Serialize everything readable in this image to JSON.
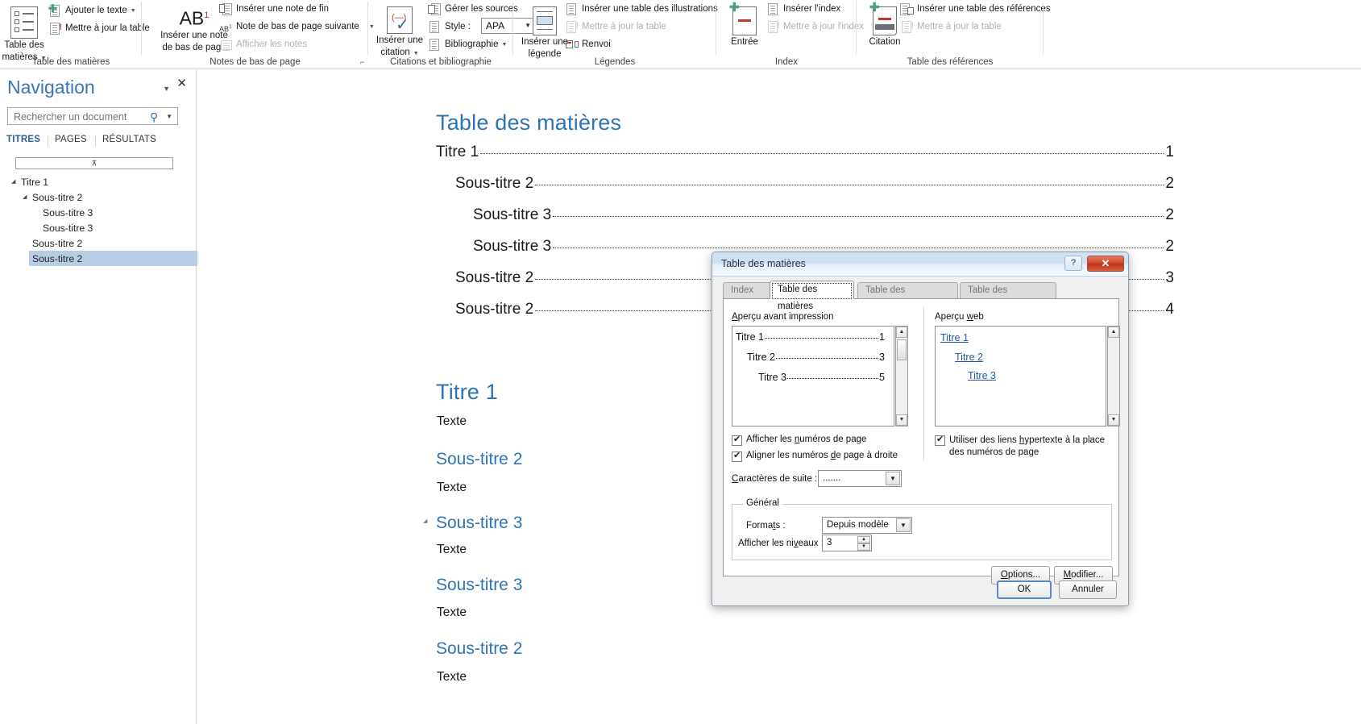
{
  "ribbon": {
    "groups": [
      {
        "name": "Table des matières",
        "big": {
          "label_line1": "Table des",
          "label_line2": "matières",
          "icon": "toc-icon"
        },
        "items": [
          {
            "label": "Ajouter le texte",
            "icon": "add-text-icon",
            "caret": true,
            "disabled": false
          },
          {
            "label": "Mettre à jour la table",
            "icon": "update-table-icon",
            "caret": false,
            "disabled": false
          }
        ]
      },
      {
        "name": "Notes de bas de page",
        "big": {
          "label_line1": "Insérer une note",
          "label_line2": "de bas de page",
          "icon": "footnote-ab-icon"
        },
        "items": [
          {
            "label": "Insérer une note de fin",
            "icon": "endnote-icon",
            "caret": false,
            "disabled": false
          },
          {
            "label": "Note de bas de page suivante",
            "icon": "next-footnote-icon",
            "caret": true,
            "disabled": false
          },
          {
            "label": "Afficher les notes",
            "icon": "show-notes-icon",
            "caret": false,
            "disabled": true
          }
        ]
      },
      {
        "name": "Citations et bibliographie",
        "big": {
          "label_line1": "Insérer une",
          "label_line2": "citation",
          "icon": "insert-citation-icon",
          "caret": true
        },
        "items": [
          {
            "label": "Gérer les sources",
            "icon": "manage-sources-icon",
            "caret": false,
            "disabled": false
          },
          {
            "label": "Style :",
            "icon": "style-icon",
            "caret": false,
            "disabled": false,
            "combo_value": "APA"
          },
          {
            "label": "Bibliographie",
            "icon": "bibliography-icon",
            "caret": true,
            "disabled": false
          }
        ]
      },
      {
        "name": "Légendes",
        "big": {
          "label_line1": "Insérer une",
          "label_line2": "légende",
          "icon": "insert-caption-icon"
        },
        "items": [
          {
            "label": "Insérer une table des illustrations",
            "icon": "table-of-figures-icon",
            "caret": false,
            "disabled": false
          },
          {
            "label": "Mettre à jour la table",
            "icon": "update-table-icon",
            "caret": false,
            "disabled": true
          },
          {
            "label": "Renvoi",
            "icon": "cross-reference-icon",
            "caret": false,
            "disabled": false
          }
        ]
      },
      {
        "name": "Index",
        "big": {
          "label_line1": "Entrée",
          "label_line2": "",
          "icon": "mark-entry-icon"
        },
        "items": [
          {
            "label": "Insérer l'index",
            "icon": "insert-index-icon",
            "caret": false,
            "disabled": false
          },
          {
            "label": "Mettre à jour l'index",
            "icon": "update-index-icon",
            "caret": false,
            "disabled": true
          }
        ]
      },
      {
        "name": "Table des références",
        "big": {
          "label_line1": "Citation",
          "label_line2": "",
          "icon": "mark-citation-icon"
        },
        "items": [
          {
            "label": "Insérer une table des références",
            "icon": "insert-authorities-icon",
            "caret": false,
            "disabled": false
          },
          {
            "label": "Mettre à jour la table",
            "icon": "update-table-icon",
            "caret": false,
            "disabled": true
          }
        ]
      }
    ]
  },
  "navigation": {
    "title": "Navigation",
    "dropdown_icon": "chevron-down-icon",
    "close_icon": "close-icon",
    "search": {
      "placeholder": "Rechercher un document",
      "value": "",
      "icon": "search-icon",
      "caret_icon": "chevron-down-icon"
    },
    "tabs": [
      {
        "label": "TITRES",
        "active": true
      },
      {
        "label": "PAGES",
        "active": false
      },
      {
        "label": "RÉSULTATS",
        "active": false
      }
    ],
    "collapse_all_icon": "collapse-all-icon",
    "headings": [
      {
        "label": "Titre 1",
        "level": 1,
        "expander": true,
        "selected": false
      },
      {
        "label": "Sous-titre 2",
        "level": 2,
        "expander": true,
        "selected": false
      },
      {
        "label": "Sous-titre 3",
        "level": 3,
        "expander": false,
        "selected": false
      },
      {
        "label": "Sous-titre 3",
        "level": 3,
        "expander": false,
        "selected": false
      },
      {
        "label": "Sous-titre 2",
        "level": 2,
        "expander": false,
        "selected": false
      },
      {
        "label": "Sous-titre 2",
        "level": 2,
        "expander": false,
        "selected": true
      }
    ]
  },
  "document": {
    "toc_title": "Table des matières",
    "toc_entries": [
      {
        "label": "Titre 1",
        "level": 1,
        "page": "1"
      },
      {
        "label": "Sous-titre 2",
        "level": 2,
        "page": "2"
      },
      {
        "label": "Sous-titre 3",
        "level": 3,
        "page": "2"
      },
      {
        "label": "Sous-titre 3",
        "level": 3,
        "page": "2"
      },
      {
        "label": "Sous-titre 2",
        "level": 2,
        "page": "3"
      },
      {
        "label": "Sous-titre 2",
        "level": 2,
        "page": "4"
      }
    ],
    "blocks": [
      {
        "kind": "h1",
        "text": "Titre 1"
      },
      {
        "kind": "body",
        "text": "Texte"
      },
      {
        "kind": "h2",
        "text": "Sous-titre 2"
      },
      {
        "kind": "body",
        "text": "Texte"
      },
      {
        "kind": "h3",
        "text": "Sous-titre 3"
      },
      {
        "kind": "body",
        "text": "Texte"
      },
      {
        "kind": "h3",
        "text": "Sous-titre 3"
      },
      {
        "kind": "body",
        "text": "Texte"
      },
      {
        "kind": "h2",
        "text": "Sous-titre 2"
      },
      {
        "kind": "body",
        "text": "Texte"
      }
    ]
  },
  "dialog": {
    "title": "Table des matières",
    "help_label": "?",
    "close_label": "✕",
    "tabs": [
      {
        "label": "Index",
        "active": false
      },
      {
        "label": "Table des matières",
        "active": true
      },
      {
        "label": "Table des illustrations",
        "active": false
      },
      {
        "label": "Table des références",
        "active": false
      }
    ],
    "print_preview": {
      "label": "Aperçu avant impression",
      "entries": [
        {
          "text": "Titre 1",
          "page": "1",
          "level": 1
        },
        {
          "text": "Titre 2",
          "page": "3",
          "level": 2
        },
        {
          "text": "Titre 3",
          "page": "5",
          "level": 3
        }
      ]
    },
    "web_preview": {
      "label": "Aperçu web",
      "entries": [
        {
          "text": "Titre 1",
          "level": 1
        },
        {
          "text": "Titre 2",
          "level": 2
        },
        {
          "text": "Titre 3",
          "level": 3
        }
      ]
    },
    "checkboxes": [
      {
        "label": "Afficher les numéros de page",
        "checked": true
      },
      {
        "label": "Aligner les numéros de page à droite",
        "checked": true
      },
      {
        "label": "Utiliser des liens hypertexte à la place des numéros de page",
        "checked": true
      }
    ],
    "tab_leader": {
      "label": "Caractères de suite :",
      "value": "......."
    },
    "general": {
      "title": "Général",
      "format_label": "Formats :",
      "format_value": "Depuis modèle",
      "levels_label": "Afficher les niveaux :",
      "levels_value": "3"
    },
    "buttons": {
      "options": "Options...",
      "modify": "Modifier...",
      "ok": "OK",
      "cancel": "Annuler"
    }
  }
}
